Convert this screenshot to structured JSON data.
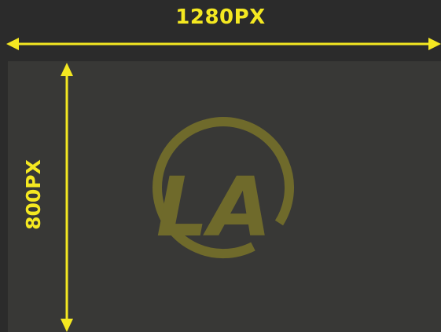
{
  "labels": {
    "width": "1280PX",
    "height": "800PX"
  },
  "logo": {
    "text": "LA"
  },
  "colors": {
    "accent": "#f4e821",
    "logo": "#6f6a2b",
    "screen": "#383836",
    "background": "#2b2b2b"
  }
}
